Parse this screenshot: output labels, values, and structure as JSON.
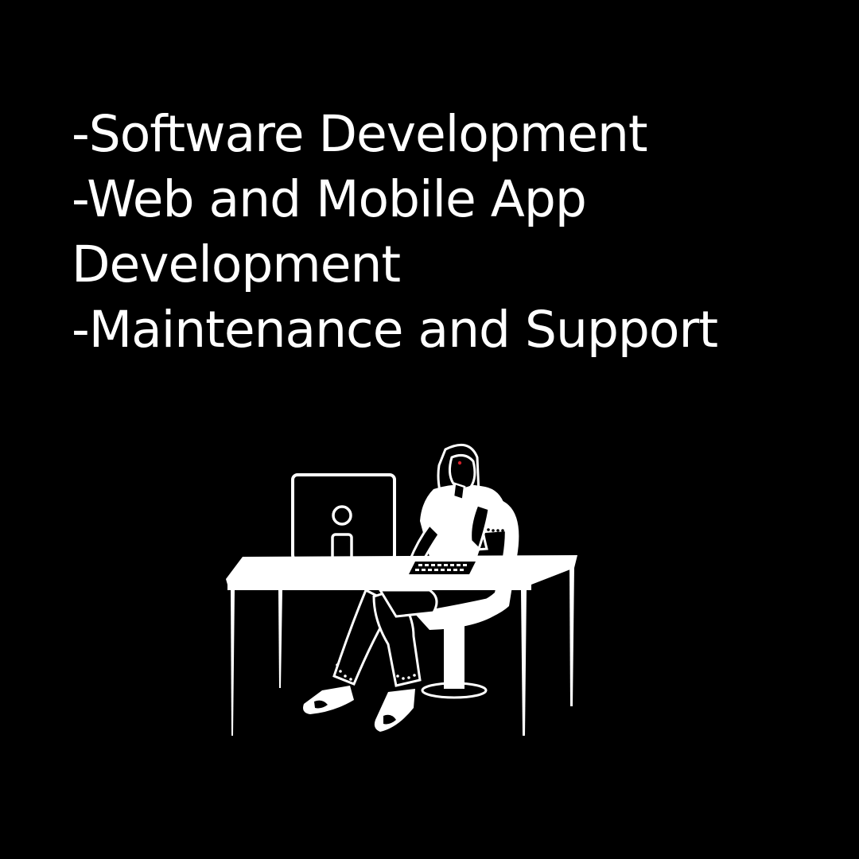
{
  "services": {
    "items": [
      "-Software Development",
      "-Web and Mobile App Development",
      "-Maintenance and Support"
    ]
  },
  "illustration": {
    "icon": "person-at-desk-with-computer-illustration"
  },
  "colors": {
    "background": "#000000",
    "text": "#ffffff",
    "accent": "#d4202a"
  }
}
